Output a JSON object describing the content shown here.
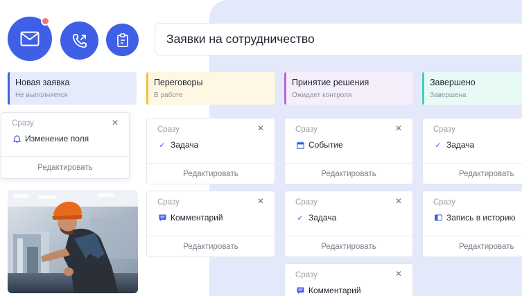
{
  "header": {
    "title": "Заявки на сотрудничество"
  },
  "toolbar": {
    "buttons": [
      {
        "icon": "mail-icon",
        "has_notification": true
      },
      {
        "icon": "phone-icon"
      },
      {
        "icon": "clipboard-icon"
      }
    ],
    "accent_color": "#3f5fe6",
    "notification_color": "#f47382"
  },
  "stages": [
    {
      "name": "Новая заявка",
      "status": "Не выполняется",
      "color": "#3f5fe6",
      "bg": "#e6ebfc"
    },
    {
      "name": "Переговоры",
      "status": "В работе",
      "color": "#f2c232",
      "bg": "#fdf7e3"
    },
    {
      "name": "Принятие решения",
      "status": "Ожидает контроля",
      "color": "#b469d6",
      "bg": "#f5eefb"
    },
    {
      "name": "Завершено",
      "status": "Завершена",
      "color": "#41d0b1",
      "bg": "#e8faf5"
    }
  ],
  "cards": {
    "edit_label": "Редактировать",
    "close_glyph": "✕",
    "col1": [
      {
        "when": "Сразу",
        "action": "Изменение поля",
        "icon": "bell-icon"
      }
    ],
    "col2": [
      {
        "when": "Сразу",
        "action": "Задача",
        "icon": "check-icon"
      },
      {
        "when": "Сразу",
        "action": "Комментарий",
        "icon": "comment-icon"
      }
    ],
    "col3": [
      {
        "when": "Сразу",
        "action": "Событие",
        "icon": "calendar-icon"
      },
      {
        "when": "Сразу",
        "action": "Задача",
        "icon": "check-icon"
      },
      {
        "when": "Сразу",
        "action": "Комментарий",
        "icon": "comment-icon"
      }
    ],
    "col4": [
      {
        "when": "Сразу",
        "action": "Задача",
        "icon": "check-icon"
      },
      {
        "when": "Сразу",
        "action": "Запись в историю",
        "icon": "history-icon"
      }
    ]
  }
}
